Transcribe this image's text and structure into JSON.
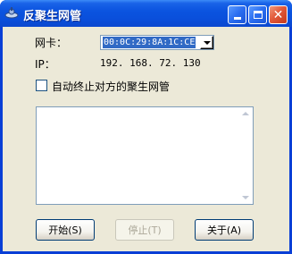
{
  "window": {
    "title": "反聚生网管",
    "icon": "network-icon",
    "controls": {
      "minimize": "minimize-icon",
      "maximize": "maximize-icon",
      "close": "close-icon",
      "close_glyph": "✕"
    }
  },
  "form": {
    "nic_label": "网卡：",
    "nic_selected": "00:0C:29:8A:1C:CE",
    "ip_label": "IP：",
    "ip_value": "192. 168. 72. 130",
    "auto_stop_label": "自动终止对方的聚生网管",
    "auto_stop_checked": false
  },
  "log": {
    "lines": []
  },
  "buttons": {
    "start_label": "开始(S)",
    "stop_label": "停止(T)",
    "about_label": "关于(A)",
    "stop_enabled": false
  }
}
